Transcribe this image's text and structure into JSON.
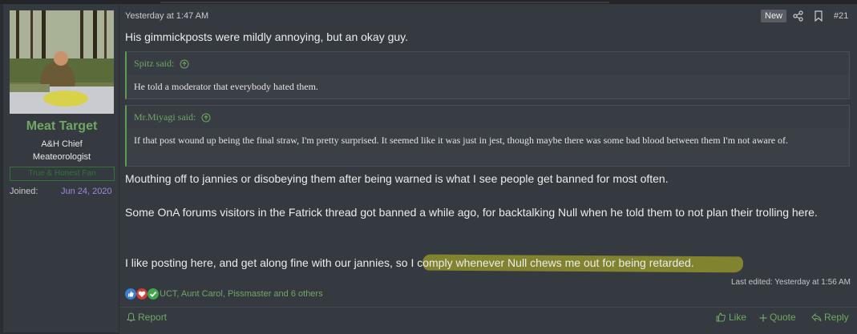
{
  "user": {
    "name": "Meat Target",
    "title_line1": "A&H Chief",
    "title_line2": "Meateorologist",
    "banner": "True & Honest Fan",
    "joined_label": "Joined:",
    "joined_date": "Jun 24, 2020"
  },
  "post": {
    "date": "Yesterday at 1:47 AM",
    "new_badge": "New",
    "number": "#21",
    "intro": "His gimmickposts were mildly annoying, but an okay guy.",
    "quotes": [
      {
        "author_line": "Spitz said:",
        "text": "He told a moderator that everybody hated them."
      },
      {
        "author_line": "Mr.Miyagi said:",
        "text": "If that post wound up being the final straw, I'm pretty surprised. It seemed like it was just in jest, though maybe there was some bad blood between them I'm not aware of."
      }
    ],
    "paragraph2": "Mouthing off to jannies or disobeying them after being warned is what I see people get banned for most often.",
    "paragraph3": "Some OnA forums visitors in the Fatrick thread got banned a while ago, for backtalking Null when he told them to not plan their trolling here.",
    "paragraph4_start": "I like posting here, and get along fine with our jannies, so ",
    "paragraph4_highlight": "I comply whenever Null chews me out for being retarded.",
    "last_edited": "Last edited: Yesterday at 1:56 AM"
  },
  "reactions": {
    "icons": [
      "thumbs-up-icon",
      "heart-icon",
      "checkmark-icon"
    ],
    "users_text": "UCT, Aunt Carol, Pissmaster and 6 others"
  },
  "footer": {
    "report": "Report",
    "like": "Like",
    "quote": "Quote",
    "reply": "Reply"
  },
  "colors": {
    "accent_green": "#6fa862",
    "highlight": "#8a8c2c",
    "join_date": "#a08ad8"
  }
}
